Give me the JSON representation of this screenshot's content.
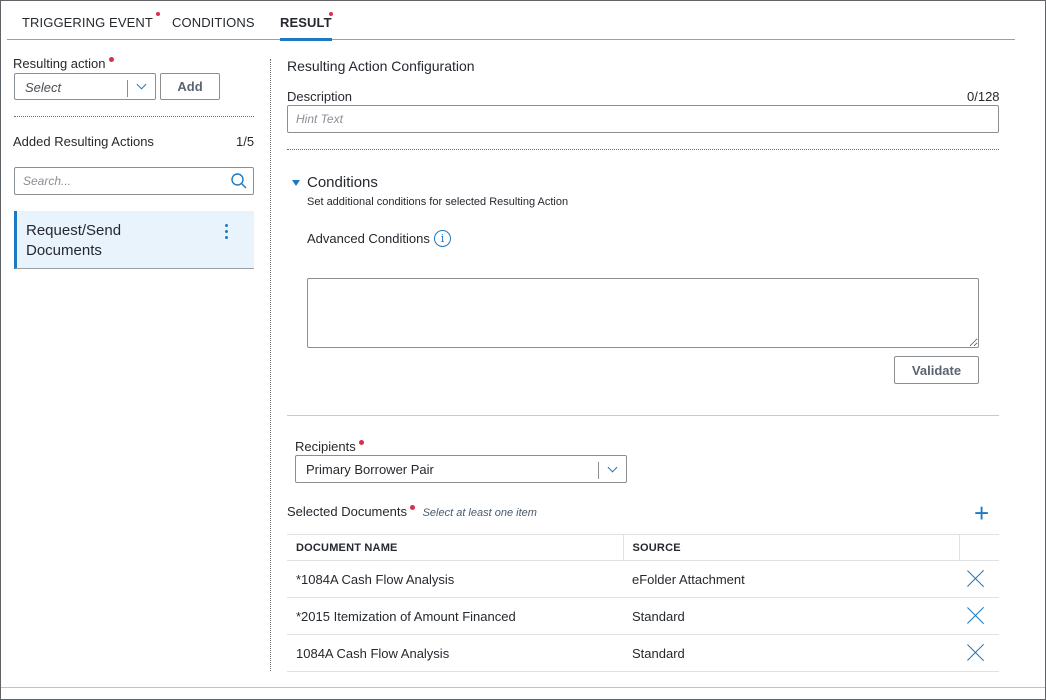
{
  "tabs": [
    {
      "label": "TRIGGERING EVENT",
      "required": true
    },
    {
      "label": "CONDITIONS",
      "required": false
    },
    {
      "label": "RESULT",
      "required": true,
      "active": true
    }
  ],
  "left_panel": {
    "resulting_action_label": "Resulting action",
    "select_value": "Select",
    "add_label": "Add",
    "added_title": "Added Resulting Actions",
    "added_count": "1/5",
    "search_placeholder": "Search...",
    "cards": [
      {
        "title": "Request/Send Documents"
      }
    ]
  },
  "config": {
    "title": "Resulting Action Configuration",
    "description_label": "Description",
    "description_counter": "0/128",
    "description_placeholder": "Hint Text",
    "conditions_title": "Conditions",
    "conditions_help": "Set additional conditions for selected Resulting Action",
    "advanced_label": "Advanced Conditions",
    "info_glyph": "i",
    "validate_label": "Validate",
    "recipients_label": "Recipients",
    "recipients_value": "Primary Borrower Pair",
    "selected_docs_label": "Selected Documents",
    "selected_docs_hint": "Select at least one item",
    "add_glyph": "+",
    "table": {
      "columns": [
        "DOCUMENT NAME",
        "SOURCE"
      ],
      "rows": [
        {
          "name": "*1084A Cash Flow Analysis",
          "source": "eFolder Attachment"
        },
        {
          "name": "*2015 Itemization of Amount Financed",
          "source": "Standard"
        },
        {
          "name": "1084A Cash Flow Analysis",
          "source": "Standard"
        }
      ]
    }
  },
  "colors": {
    "accent": "#1e79c2",
    "required": "#d9304c",
    "card_bg": "#e8f3fc"
  },
  "icons": [
    "chevron-down-icon",
    "search-icon",
    "kebab-menu-icon",
    "caret-down-icon",
    "info-icon",
    "plus-icon",
    "close-icon"
  ]
}
